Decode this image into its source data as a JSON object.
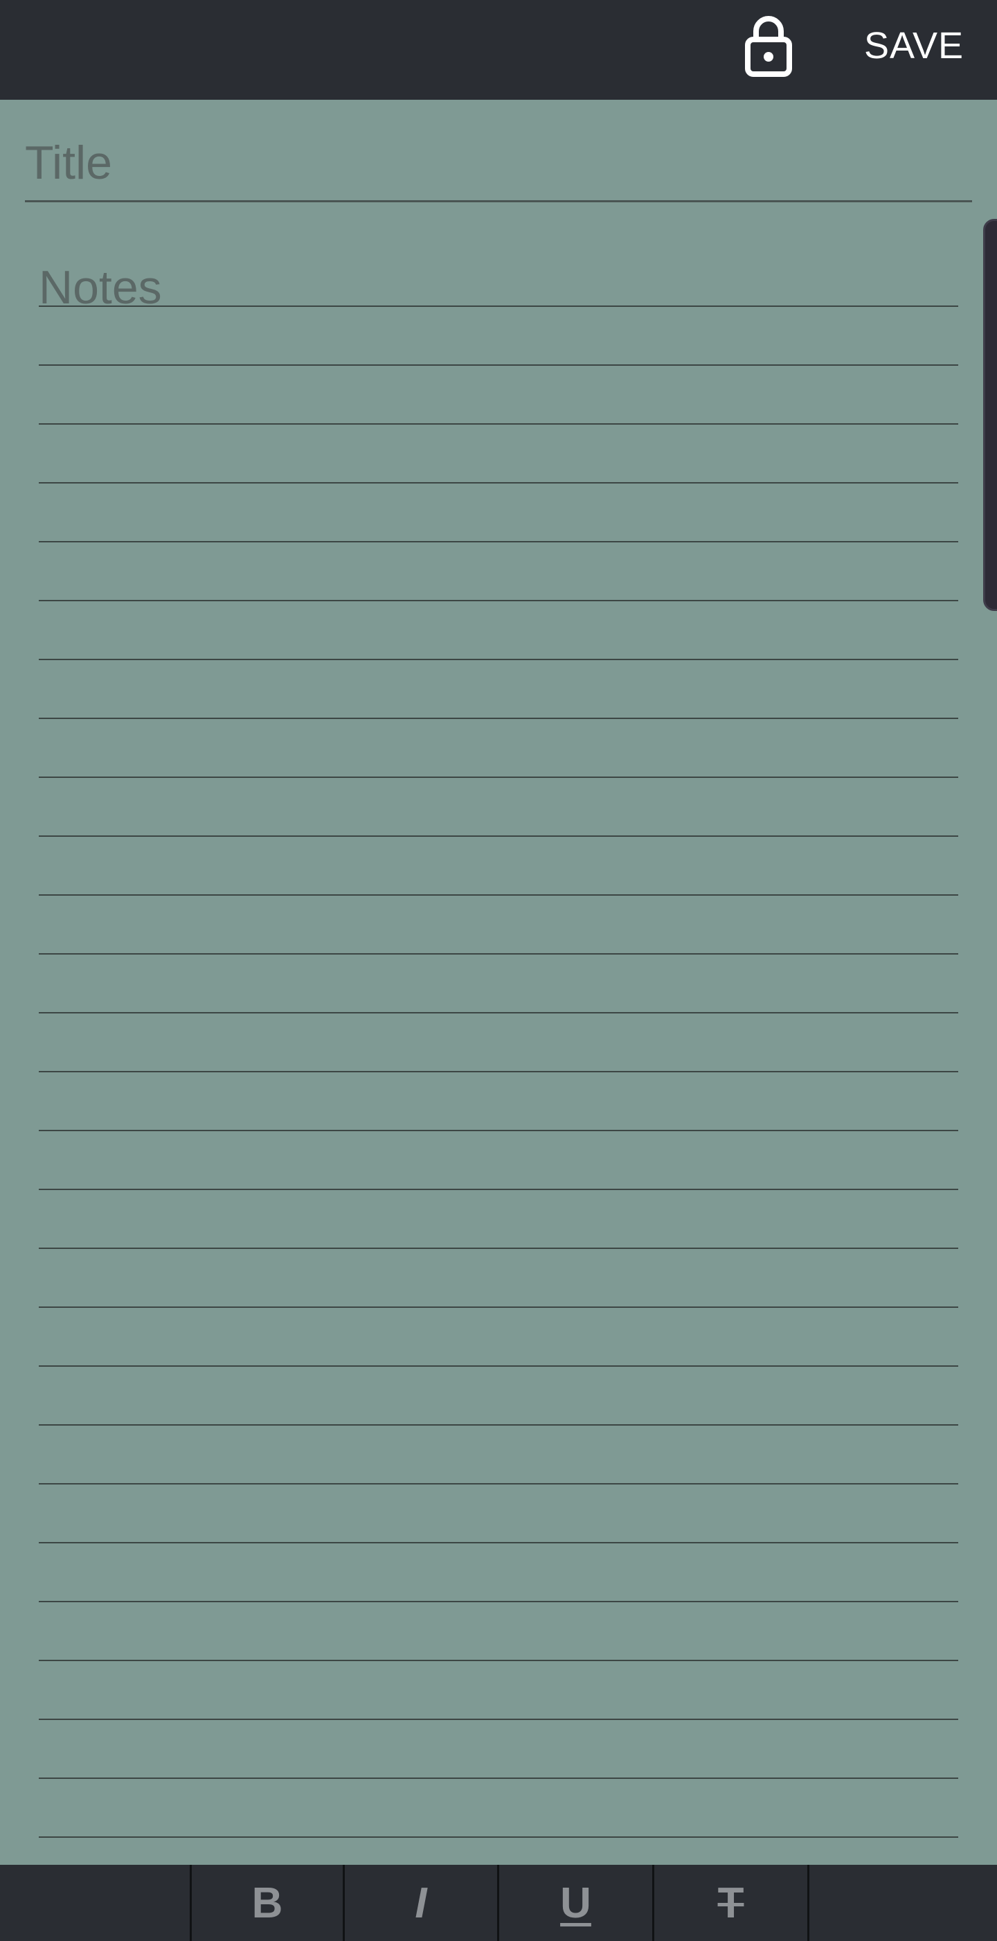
{
  "toolbar": {
    "lock_icon": "lock-icon",
    "save_label": "SAVE"
  },
  "editor": {
    "title_placeholder": "Title",
    "title_value": "",
    "notes_placeholder": "Notes",
    "notes_value": ""
  },
  "format_bar": {
    "bold_label": "B",
    "italic_label": "I",
    "underline_label": "U",
    "strikethrough_label": "T"
  },
  "colors": {
    "background": "#7f9a94",
    "bar": "#2a2d33",
    "rule": "#3c4644"
  }
}
